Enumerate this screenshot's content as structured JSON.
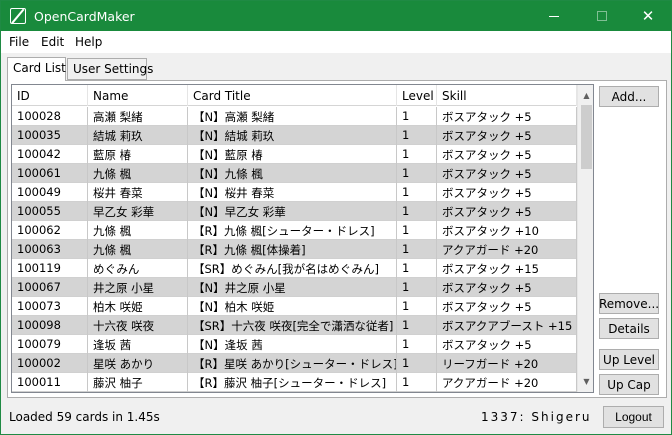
{
  "window": {
    "title": "OpenCardMaker"
  },
  "menu": [
    "File",
    "Edit",
    "Help"
  ],
  "tabs": [
    "Card List",
    "User Settings"
  ],
  "grid": {
    "columns": [
      "ID",
      "Name",
      "Card Title",
      "Level",
      "Skill"
    ],
    "rows": [
      [
        "100028",
        "高瀬 梨緒",
        "【N】高瀬 梨緒",
        "1",
        "ボスアタック +5"
      ],
      [
        "100035",
        "結城 莉玖",
        "【N】結城 莉玖",
        "1",
        "ボスアタック +5"
      ],
      [
        "100042",
        "藍原 椿",
        "【N】藍原 椿",
        "1",
        "ボスアタック +5"
      ],
      [
        "100061",
        "九條 楓",
        "【N】九條 楓",
        "1",
        "ボスアタック +5"
      ],
      [
        "100049",
        "桜井 春菜",
        "【N】桜井 春菜",
        "1",
        "ボスアタック +5"
      ],
      [
        "100055",
        "早乙女 彩華",
        "【N】早乙女 彩華",
        "1",
        "ボスアタック +5"
      ],
      [
        "100062",
        "九條 楓",
        "【R】九條 楓[シューター・ドレス]",
        "1",
        "ボスアタック +10"
      ],
      [
        "100063",
        "九條 楓",
        "【R】九條 楓[体操着]",
        "1",
        "アクアガード +20"
      ],
      [
        "100119",
        "めぐみん",
        "【SR】めぐみん[我が名はめぐみん]",
        "1",
        "ボスアタック +15"
      ],
      [
        "100067",
        "井之原 小星",
        "【N】井之原 小星",
        "1",
        "ボスアタック +5"
      ],
      [
        "100073",
        "柏木 咲姫",
        "【N】柏木 咲姫",
        "1",
        "ボスアタック +5"
      ],
      [
        "100098",
        "十六夜 咲夜",
        "【SR】十六夜 咲夜[完全で瀟洒な従者]",
        "1",
        "ボスアクアブースト +15"
      ],
      [
        "100079",
        "逢坂 茜",
        "【N】逢坂 茜",
        "1",
        "ボスアタック +5"
      ],
      [
        "100002",
        "星咲 あかり",
        "【R】星咲 あかり[シューター・ドレス]",
        "1",
        "リーフガード +20"
      ],
      [
        "100011",
        "藤沢 柚子",
        "【R】藤沢 柚子[シューター・ドレス]",
        "1",
        "アクアガード +20"
      ]
    ]
  },
  "side_buttons": {
    "add": "Add...",
    "remove": "Remove...",
    "details": "Details",
    "up_level": "Up Level",
    "up_cap": "Up Cap"
  },
  "status": {
    "loaded": "Loaded 59 cards in 1.45s",
    "user": "1337: Shigeru",
    "logout": "Logout"
  },
  "colors": {
    "titlebar": "#198a3c",
    "alt_row": "#d4d4d4"
  },
  "scrollbar": {
    "visible_fraction": 0.25
  }
}
